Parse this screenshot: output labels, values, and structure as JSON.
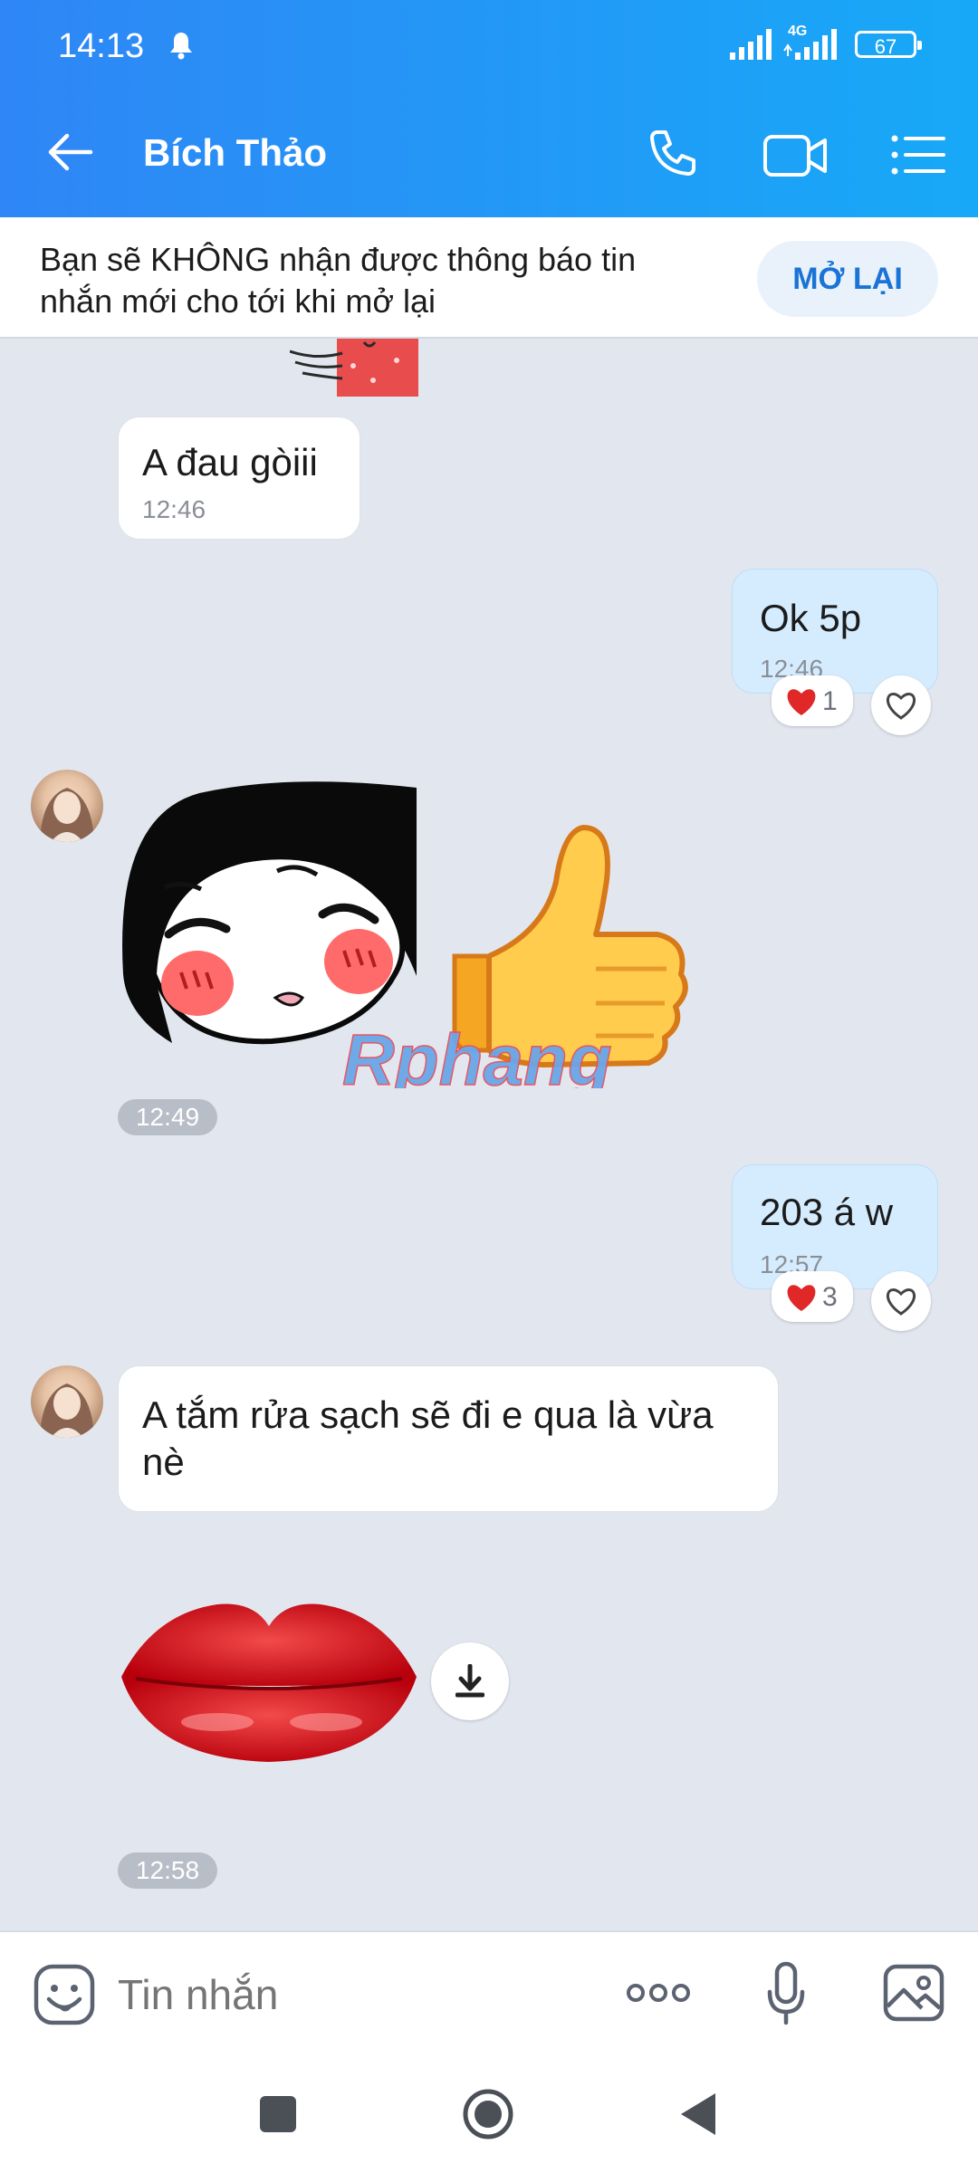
{
  "status": {
    "time": "14:13",
    "network": "4G",
    "battery": "67"
  },
  "header": {
    "title": "Bích Thảo"
  },
  "notice": {
    "text": "Bạn sẽ KHÔNG nhận được thông báo tin nhắn mới cho tới khi mở lại",
    "button": "MỞ LẠI"
  },
  "messages": [
    {
      "text": "A đau gòiii",
      "time": "12:46"
    },
    {
      "text": "Ok 5p",
      "time": "12:46",
      "reaction_count": "1"
    },
    {
      "sticker_time": "12:49",
      "watermark": "Rphang"
    },
    {
      "text": "203 á w",
      "time": "12:57",
      "reaction_count": "3"
    },
    {
      "text": "A tắm rửa sạch sẽ đi e qua là vừa nè"
    },
    {
      "sticker_time": "12:58"
    }
  ],
  "composer": {
    "placeholder": "Tin nhắn"
  },
  "icons": {
    "bell": "bell-icon",
    "back": "arrow-left-icon",
    "call": "phone-icon",
    "video": "video-camera-icon",
    "menu": "list-menu-icon",
    "heart": "heart-icon",
    "download": "download-icon",
    "emoji": "emoji-icon",
    "more": "more-dots-icon",
    "mic": "microphone-icon",
    "image": "image-icon"
  },
  "colors": {
    "header_start": "#2f86f6",
    "header_end": "#17a9f7",
    "chat_bg": "#e2e7ef",
    "my_bubble": "#d5ecfe",
    "accent": "#1a73d6"
  }
}
